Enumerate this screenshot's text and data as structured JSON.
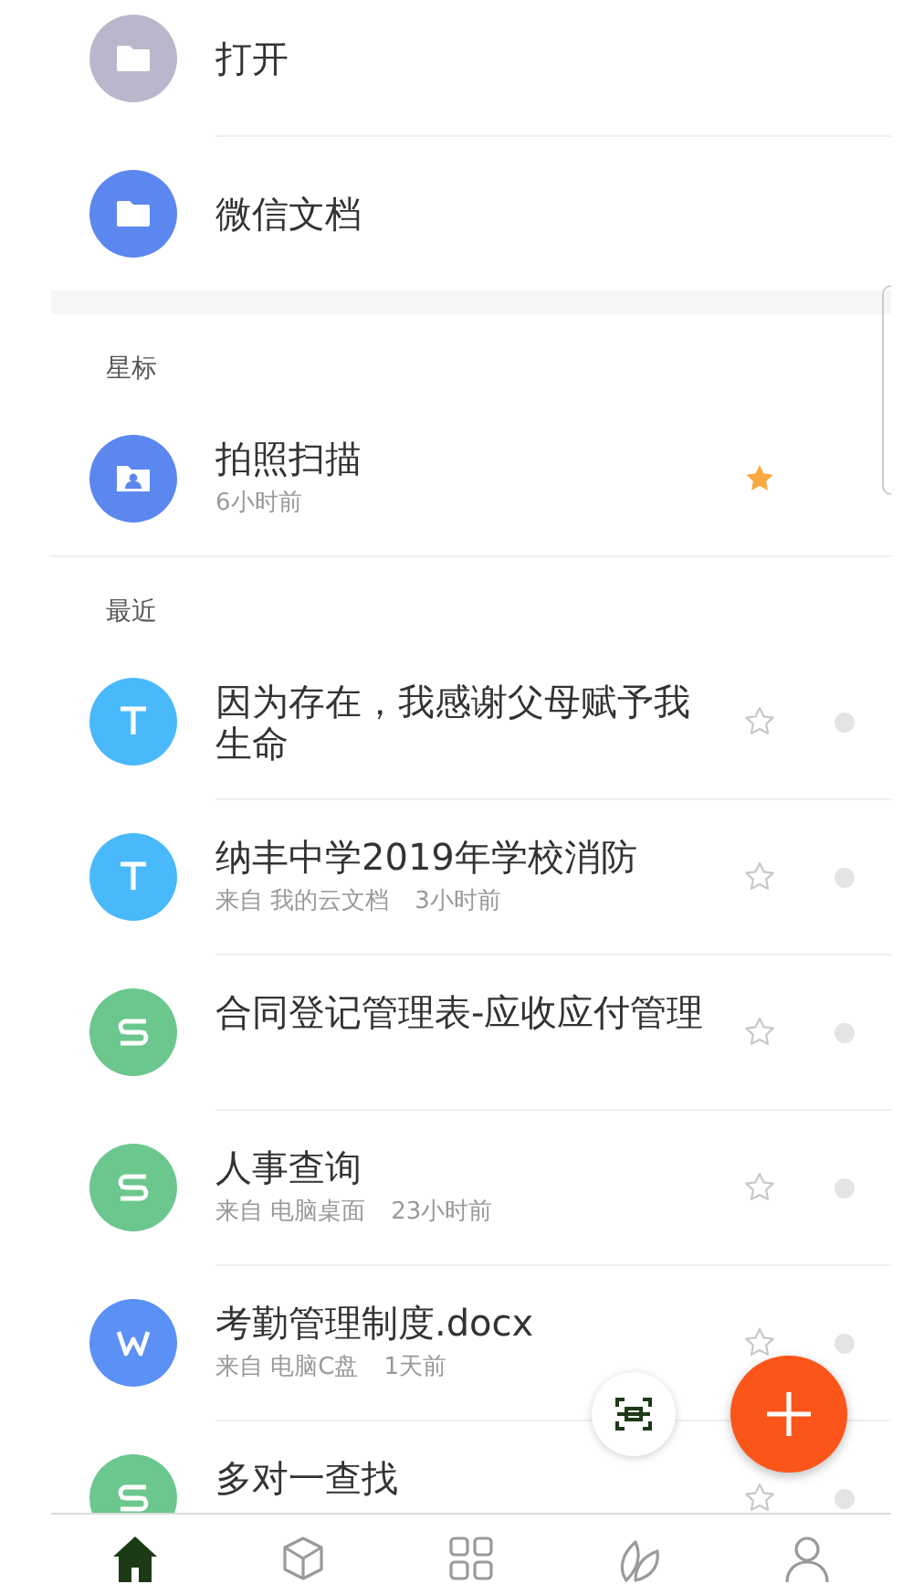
{
  "folders": [
    {
      "title": "打开",
      "kind": "folder",
      "color": "#bab7cc"
    },
    {
      "title": "微信文档",
      "kind": "folder",
      "color": "#5b87ee"
    }
  ],
  "starred": {
    "header": "星标",
    "items": [
      {
        "title": "拍照扫描",
        "kind": "scan",
        "color": "#5b87ee",
        "time": "6小时前",
        "starred": true
      }
    ]
  },
  "recent": {
    "header": "最近",
    "items": [
      {
        "title": "因为存在，我感谢父母赋予我生命",
        "kind": "text",
        "color": "#4ab9fb",
        "starred": false
      },
      {
        "title": "纳丰中学2019年学校消防",
        "kind": "text",
        "color": "#4ab9fb",
        "source": "来自 我的云文档",
        "time": "3小时前",
        "starred": false
      },
      {
        "title": "合同登记管理表-应收应付管理",
        "kind": "sheet",
        "color": "#6bc78e",
        "starred": false
      },
      {
        "title": "人事查询",
        "kind": "sheet",
        "color": "#6bc78e",
        "source": "来自 电脑桌面",
        "time": "23小时前",
        "starred": false
      },
      {
        "title": "考勤管理制度.docx",
        "kind": "writer",
        "color": "#5b90f5",
        "source": "来自 电脑C盘",
        "time": "1天前",
        "starred": false
      },
      {
        "title": "多对一查找",
        "kind": "sheet",
        "color": "#6bc78e",
        "starred": false
      }
    ]
  },
  "nav": [
    {
      "kind": "home",
      "selected": true
    },
    {
      "kind": "cube",
      "selected": false
    },
    {
      "kind": "apps",
      "selected": false
    },
    {
      "kind": "leaf",
      "selected": false
    },
    {
      "kind": "person",
      "selected": false
    }
  ]
}
